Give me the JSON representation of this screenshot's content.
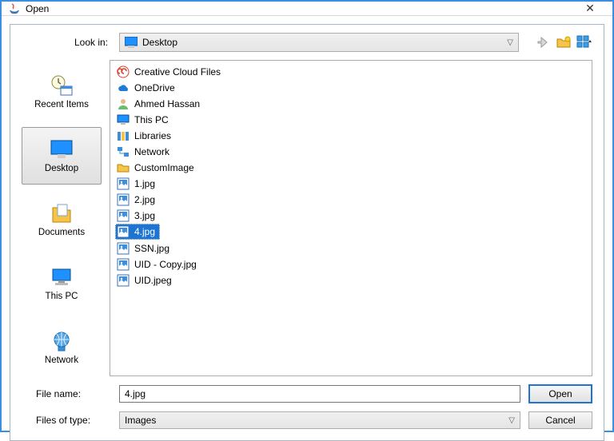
{
  "window": {
    "title": "Open"
  },
  "look_in": {
    "label": "Look in:",
    "value": "Desktop"
  },
  "toolbar_icons": [
    "up-one-level-icon",
    "new-folder-icon",
    "view-menu-icon"
  ],
  "sidebar": {
    "items": [
      {
        "label": "Recent Items",
        "icon": "recent-icon"
      },
      {
        "label": "Desktop",
        "icon": "desktop-icon",
        "selected": true
      },
      {
        "label": "Documents",
        "icon": "documents-icon"
      },
      {
        "label": "This PC",
        "icon": "pc-icon"
      },
      {
        "label": "Network",
        "icon": "network-icon"
      }
    ]
  },
  "files": [
    {
      "label": "Creative Cloud Files",
      "icon": "cc-icon"
    },
    {
      "label": "OneDrive",
      "icon": "onedrive-icon"
    },
    {
      "label": "Ahmed Hassan",
      "icon": "user-icon"
    },
    {
      "label": "This PC",
      "icon": "pc-small-icon"
    },
    {
      "label": "Libraries",
      "icon": "libraries-icon"
    },
    {
      "label": "Network",
      "icon": "network-small-icon"
    },
    {
      "label": "CustomImage",
      "icon": "folder-icon"
    },
    {
      "label": "1.jpg",
      "icon": "image-icon"
    },
    {
      "label": "2.jpg",
      "icon": "image-icon"
    },
    {
      "label": "3.jpg",
      "icon": "image-icon"
    },
    {
      "label": "4.jpg",
      "icon": "image-icon",
      "selected": true
    },
    {
      "label": "SSN.jpg",
      "icon": "image-icon"
    },
    {
      "label": "UID - Copy.jpg",
      "icon": "image-icon"
    },
    {
      "label": "UID.jpeg",
      "icon": "image-icon"
    }
  ],
  "file_name": {
    "label": "File name:",
    "value": "4.jpg"
  },
  "file_type": {
    "label": "Files of type:",
    "value": "Images"
  },
  "buttons": {
    "open": "Open",
    "cancel": "Cancel"
  }
}
